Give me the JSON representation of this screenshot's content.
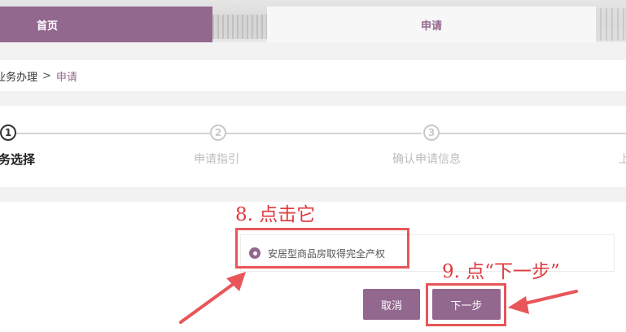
{
  "nav": {
    "home_label": "首页",
    "apply_label": "申请"
  },
  "breadcrumb": {
    "first": "业务办理",
    "separator": ">",
    "current": "申请"
  },
  "steps": [
    {
      "number": "1",
      "label": "务选择",
      "active": true
    },
    {
      "number": "2",
      "label": "申请指引",
      "active": false
    },
    {
      "number": "3",
      "label": "确认申请信息",
      "active": false
    },
    {
      "number": "",
      "label": "上",
      "active": false
    }
  ],
  "form": {
    "option_label": "安居型商品房取得完全产权",
    "option_selected": true
  },
  "buttons": {
    "cancel_label": "取消",
    "next_label": "下一步"
  },
  "annotations": {
    "click_it": "8. 点击它",
    "click_next": "9. 点“下一步”",
    "color": "#e8565a"
  },
  "colors": {
    "accent": "#93688f"
  }
}
